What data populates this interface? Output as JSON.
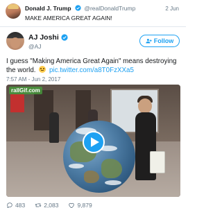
{
  "quoted_tweet": {
    "author_name": "Donald J. Trump",
    "author_handle": "@realDonaldTrump",
    "date": "2 Jun",
    "text": "MAKE AMERICA GREAT AGAIN!"
  },
  "tweet": {
    "author_name": "AJ Joshi",
    "author_handle": "@AJ",
    "follow_label": "Follow",
    "text_line1": "I guess \"Making America Great Again\" means destroying the",
    "text_line2_prefix": "world.",
    "link": "pic.twitter.com/a8T0FzXXa5",
    "timestamp": "7:57 AM - Jun 2, 2017",
    "media_watermark": "rallGif.com",
    "reply_count": "483",
    "retweet_count": "2,083",
    "like_count": "9,879"
  },
  "colors": {
    "accent": "#1da1f2",
    "muted_text": "#657786",
    "divider": "#e1e8ed"
  },
  "icons": {
    "verified": "verified-badge-icon",
    "follow": "add-person-icon",
    "play": "play-icon",
    "reply": "reply-icon",
    "retweet": "retweet-icon",
    "like": "heart-icon",
    "emoji": "grinning-face-icon"
  }
}
